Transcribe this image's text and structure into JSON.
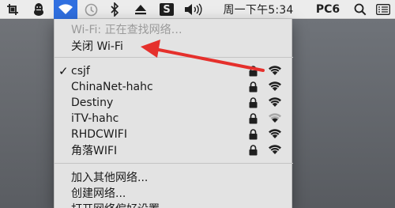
{
  "menubar": {
    "clock": "周一下午5:34",
    "brand": "PC6",
    "s_icon_letter": "S"
  },
  "wifi_menu": {
    "status": "Wi-Fi: 正在查找网络…",
    "toggle_label": "关闭 Wi-Fi",
    "networks": [
      {
        "name": "csjf",
        "connected": true,
        "locked": true,
        "signal": "full"
      },
      {
        "name": "ChinaNet-hahc",
        "connected": false,
        "locked": true,
        "signal": "full"
      },
      {
        "name": "Destiny",
        "connected": false,
        "locked": true,
        "signal": "full"
      },
      {
        "name": "iTV-hahc",
        "connected": false,
        "locked": true,
        "signal": "weak"
      },
      {
        "name": "RHDCWIFI",
        "connected": false,
        "locked": true,
        "signal": "full"
      },
      {
        "name": "角落WIFI",
        "connected": false,
        "locked": true,
        "signal": "full"
      }
    ],
    "join_other": "加入其他网络...",
    "create_network": "创建网络...",
    "open_prefs": "打开网络偏好设置..."
  },
  "colors": {
    "menubar_bg": "#ececec",
    "highlight": "#2f6fe0",
    "menu_bg": "#e3e3e3",
    "arrow": "#e5302c"
  },
  "icons": [
    "crop-icon",
    "qq-penguin-icon",
    "wifi-icon",
    "time-machine-icon",
    "bluetooth-icon",
    "eject-icon",
    "s-app-icon",
    "volume-icon",
    "search-icon",
    "list-menu-icon",
    "lock-icon",
    "wifi-signal-icon",
    "checkmark-icon"
  ]
}
